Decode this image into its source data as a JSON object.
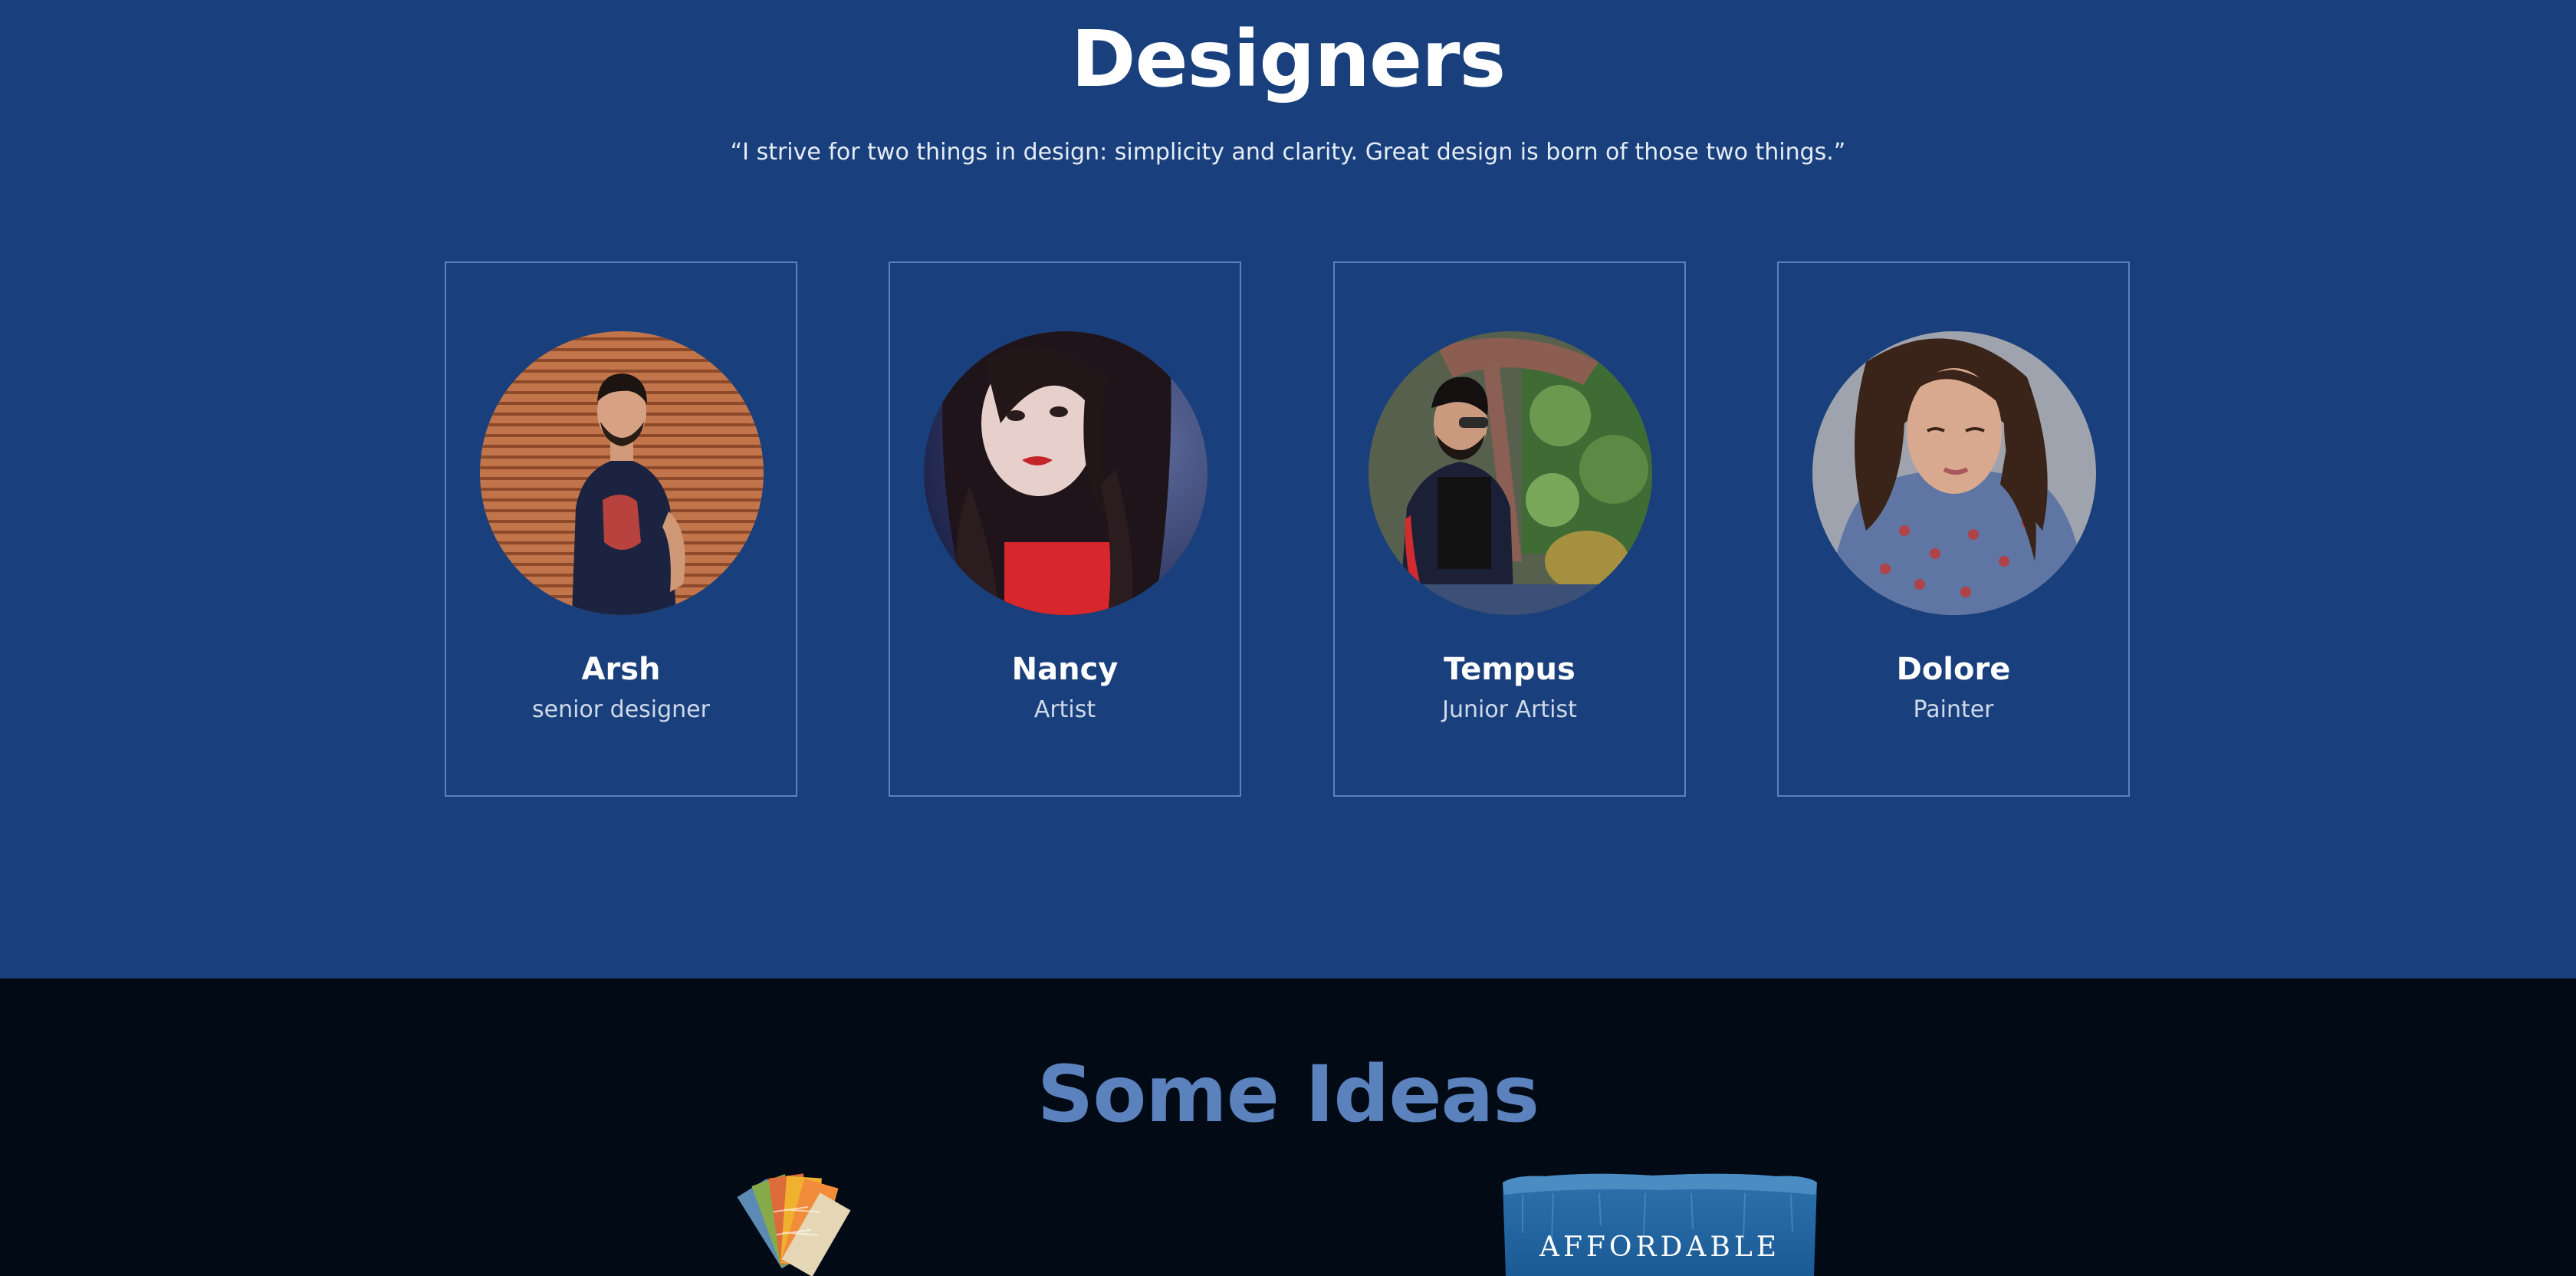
{
  "designers": {
    "title": "Designers",
    "quote": "“I strive for two things in design: simplicity and clarity. Great design is born of those two things.”",
    "members": [
      {
        "name": "Arsh",
        "role": "senior designer"
      },
      {
        "name": "Nancy",
        "role": "Artist"
      },
      {
        "name": "Tempus",
        "role": "Junior Artist"
      },
      {
        "name": "Dolore",
        "role": "Painter"
      }
    ]
  },
  "ideas": {
    "title": "Some Ideas",
    "cards": [
      {
        "image": "paint-swatches-image"
      },
      {
        "image": "affordable-paint-bucket-image",
        "label": "AFFORDABLE"
      }
    ]
  },
  "colors": {
    "designers_bg": "#19407c",
    "ideas_bg": "#020a16",
    "ideas_title": "#5b82bd",
    "card_border": "#5e81b8"
  }
}
